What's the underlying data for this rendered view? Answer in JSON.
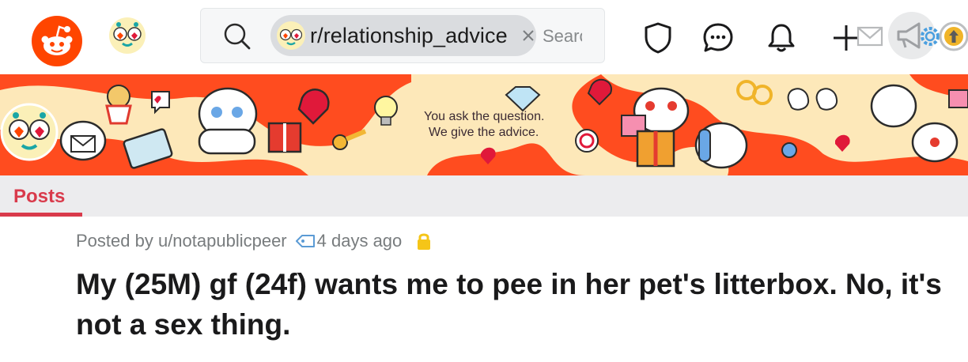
{
  "header": {
    "search": {
      "subreddit_chip": "r/relationship_advice",
      "placeholder": "Search"
    }
  },
  "banner": {
    "line1": "You ask the question.",
    "line2": "We give the advice."
  },
  "tabs": [
    {
      "label": "Posts",
      "active": true
    }
  ],
  "post": {
    "posted_by": "Posted by u/notapublicpeer",
    "time": "4 days ago",
    "locked": true,
    "title": "My (25M) gf (24f) wants me to pee in her pet's litterbox. No, it's not a sex thing."
  },
  "colors": {
    "reddit_orange": "#ff4500",
    "banner_bg": "#fde8b9",
    "banner_swoosh": "#ff4c1f",
    "tab_accent": "#d93a4b",
    "lock": "#f5c518"
  },
  "icons": [
    "reddit-logo-icon",
    "subreddit-icon",
    "search-icon",
    "close-icon",
    "shield-icon",
    "chat-icon",
    "bell-icon",
    "plus-icon",
    "mail-icon",
    "megaphone-icon",
    "gear-icon",
    "upvote-icon",
    "tag-icon",
    "lock-icon"
  ]
}
